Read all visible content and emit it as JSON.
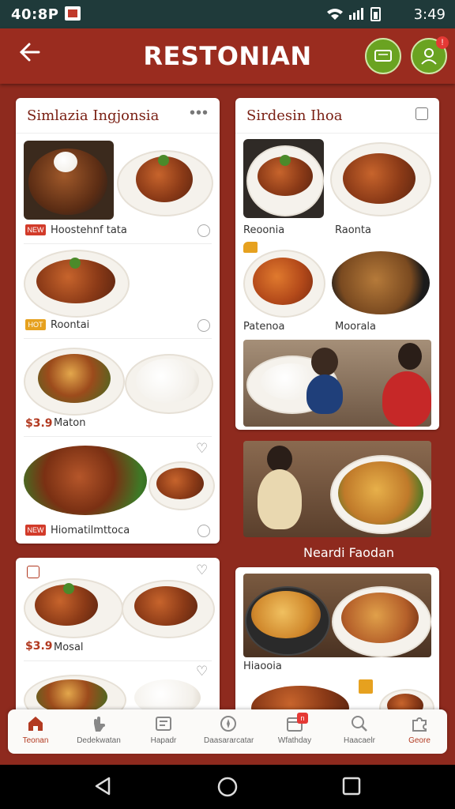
{
  "status": {
    "time_left": "40:8P",
    "time_right": "3:49"
  },
  "appbar": {
    "title": "RESTONIAN"
  },
  "left_card1": {
    "title": "Simlazia Ingjonsia",
    "items": [
      {
        "label": "Hoostehnf tata",
        "tag": "NEW"
      },
      {
        "label": "Roontai",
        "tag": "HOT"
      },
      {
        "price": "$3.9",
        "label": "Maton"
      },
      {
        "label": "Hiomatilmttoca",
        "tag": "NEW"
      }
    ]
  },
  "left_card2": {
    "items": [
      {
        "price": "$3.9",
        "label": "Mosal"
      }
    ]
  },
  "right_card1": {
    "title": "Sirdesin Ihoa",
    "items": [
      {
        "label": "Reoonia"
      },
      {
        "label": "Raonta"
      },
      {
        "label": "Patenoa"
      },
      {
        "label": "Moorala"
      }
    ]
  },
  "right_section": {
    "caption": "Neardi Faodan"
  },
  "right_card2": {
    "items": [
      {
        "label": "Hiaooia"
      }
    ]
  },
  "bottom_nav": [
    {
      "label": "Teonan",
      "icon": "home-icon",
      "active": true
    },
    {
      "label": "Dedekwatan",
      "icon": "hand-icon"
    },
    {
      "label": "Hapadr",
      "icon": "menu-board-icon"
    },
    {
      "label": "Daasararcatar",
      "icon": "compass-icon"
    },
    {
      "label": "Wfathday",
      "icon": "calendar-icon",
      "badge": "n"
    },
    {
      "label": "Haacaelr",
      "icon": "search-icon"
    },
    {
      "label": "Geore",
      "icon": "puzzle-icon"
    }
  ]
}
